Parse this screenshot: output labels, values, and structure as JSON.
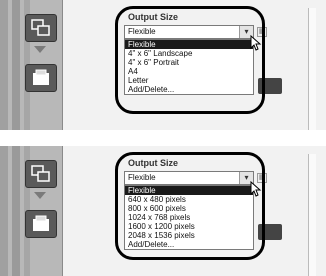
{
  "top_panel": {
    "group_label": "Output Size",
    "combo_value": "Flexible",
    "options": [
      "Flexible",
      "4\" x 6\" Landscape",
      "4\" x 6\" Portrait",
      "A4",
      "Letter",
      "Add/Delete..."
    ],
    "selected_index": 0
  },
  "bottom_panel": {
    "group_label": "Output Size",
    "combo_value": "Flexible",
    "options": [
      "Flexible",
      "640 x 480 pixels",
      "800 x 600 pixels",
      "1024 x 768 pixels",
      "1600 x 1200 pixels",
      "2048 x 1536 pixels",
      "Add/Delete..."
    ],
    "selected_index": 0
  },
  "icons": {
    "tool_button_1": "layers-icon",
    "tool_button_2": "page-icon",
    "flow_arrow": "down-arrow-icon",
    "combo_dropdown": "chevron-down-icon",
    "side_icon": "grid-icon",
    "pointer": "cursor-icon"
  }
}
